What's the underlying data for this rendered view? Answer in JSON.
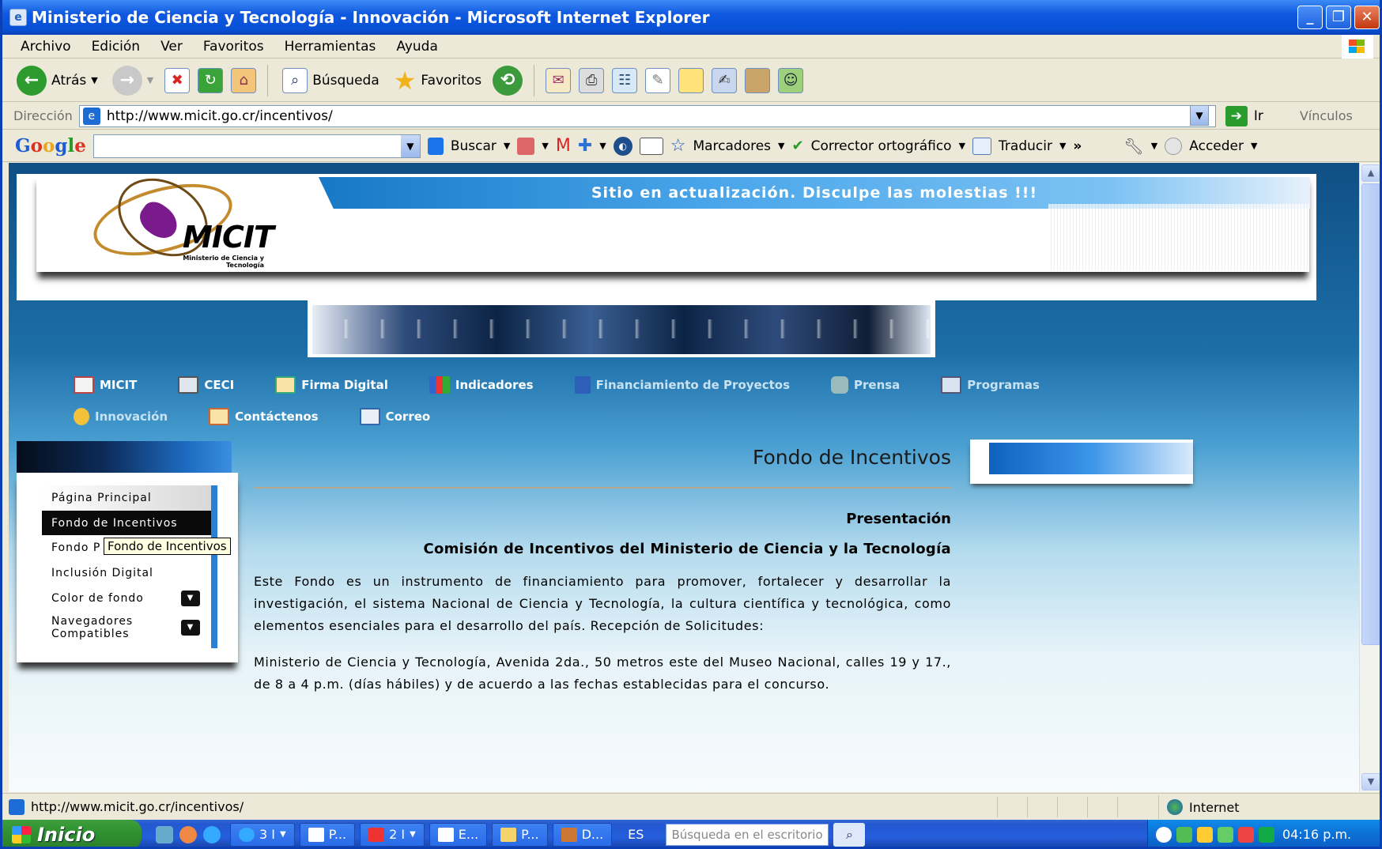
{
  "window": {
    "title": "Ministerio de Ciencia y Tecnología - Innovación - Microsoft Internet Explorer"
  },
  "menu": [
    "Archivo",
    "Edición",
    "Ver",
    "Favoritos",
    "Herramientas",
    "Ayuda"
  ],
  "toolbar": {
    "back": "Atrás",
    "search": "Búsqueda",
    "favorites": "Favoritos"
  },
  "address": {
    "label": "Dirección",
    "url": "http://www.micit.go.cr/incentivos/",
    "go": "Ir",
    "links": "Vínculos"
  },
  "google": {
    "logo": "Google",
    "search": "Buscar",
    "bookmarks": "Marcadores",
    "spell": "Corrector ortográfico",
    "translate": "Traducir",
    "signin": "Acceder"
  },
  "page": {
    "banner": "Sitio en actualización. Disculpe las molestias !!!",
    "logo": {
      "name": "MICIT",
      "subtitle": "Ministerio de Ciencia y Tecnología"
    },
    "nav": [
      "MICIT",
      "CECI",
      "Firma Digital",
      "Indicadores",
      "Financiamiento de Proyectos",
      "Prensa",
      "Programas",
      "Innovación",
      "Contáctenos",
      "Correo"
    ],
    "side": [
      "Página Principal",
      "Fondo de Incentivos",
      "Fondo P",
      "Inclusión Digital",
      "Color de fondo",
      "Navegadores Compatibles"
    ],
    "tooltip": "Fondo de Incentivos",
    "title": "Fondo de Incentivos",
    "section": "Presentación",
    "subtitle": "Comisión de Incentivos del Ministerio de Ciencia y la Tecnología",
    "p1": "Este Fondo es un instrumento de financiamiento para promover, fortalecer y desarrollar la investigación, el sistema Nacional de Ciencia y Tecnología, la cultura científica y tecnológica, como elementos esenciales para el desarrollo del país. Recepción de Solicitudes:",
    "p2": "Ministerio de Ciencia y Tecnología, Avenida 2da., 50 metros este del Museo Nacional, calles 19 y 17., de 8 a 4 p.m. (días hábiles) y de acuerdo a las fechas establecidas para el concurso."
  },
  "status": {
    "url": "http://www.micit.go.cr/incentivos/",
    "zone": "Internet"
  },
  "taskbar": {
    "start": "Inicio",
    "items": [
      "3 I",
      "P...",
      "2 I",
      "E...",
      "P...",
      "D..."
    ],
    "lang": "ES",
    "search_placeholder": "Búsqueda en el escritorio",
    "clock": "04:16 p.m."
  }
}
